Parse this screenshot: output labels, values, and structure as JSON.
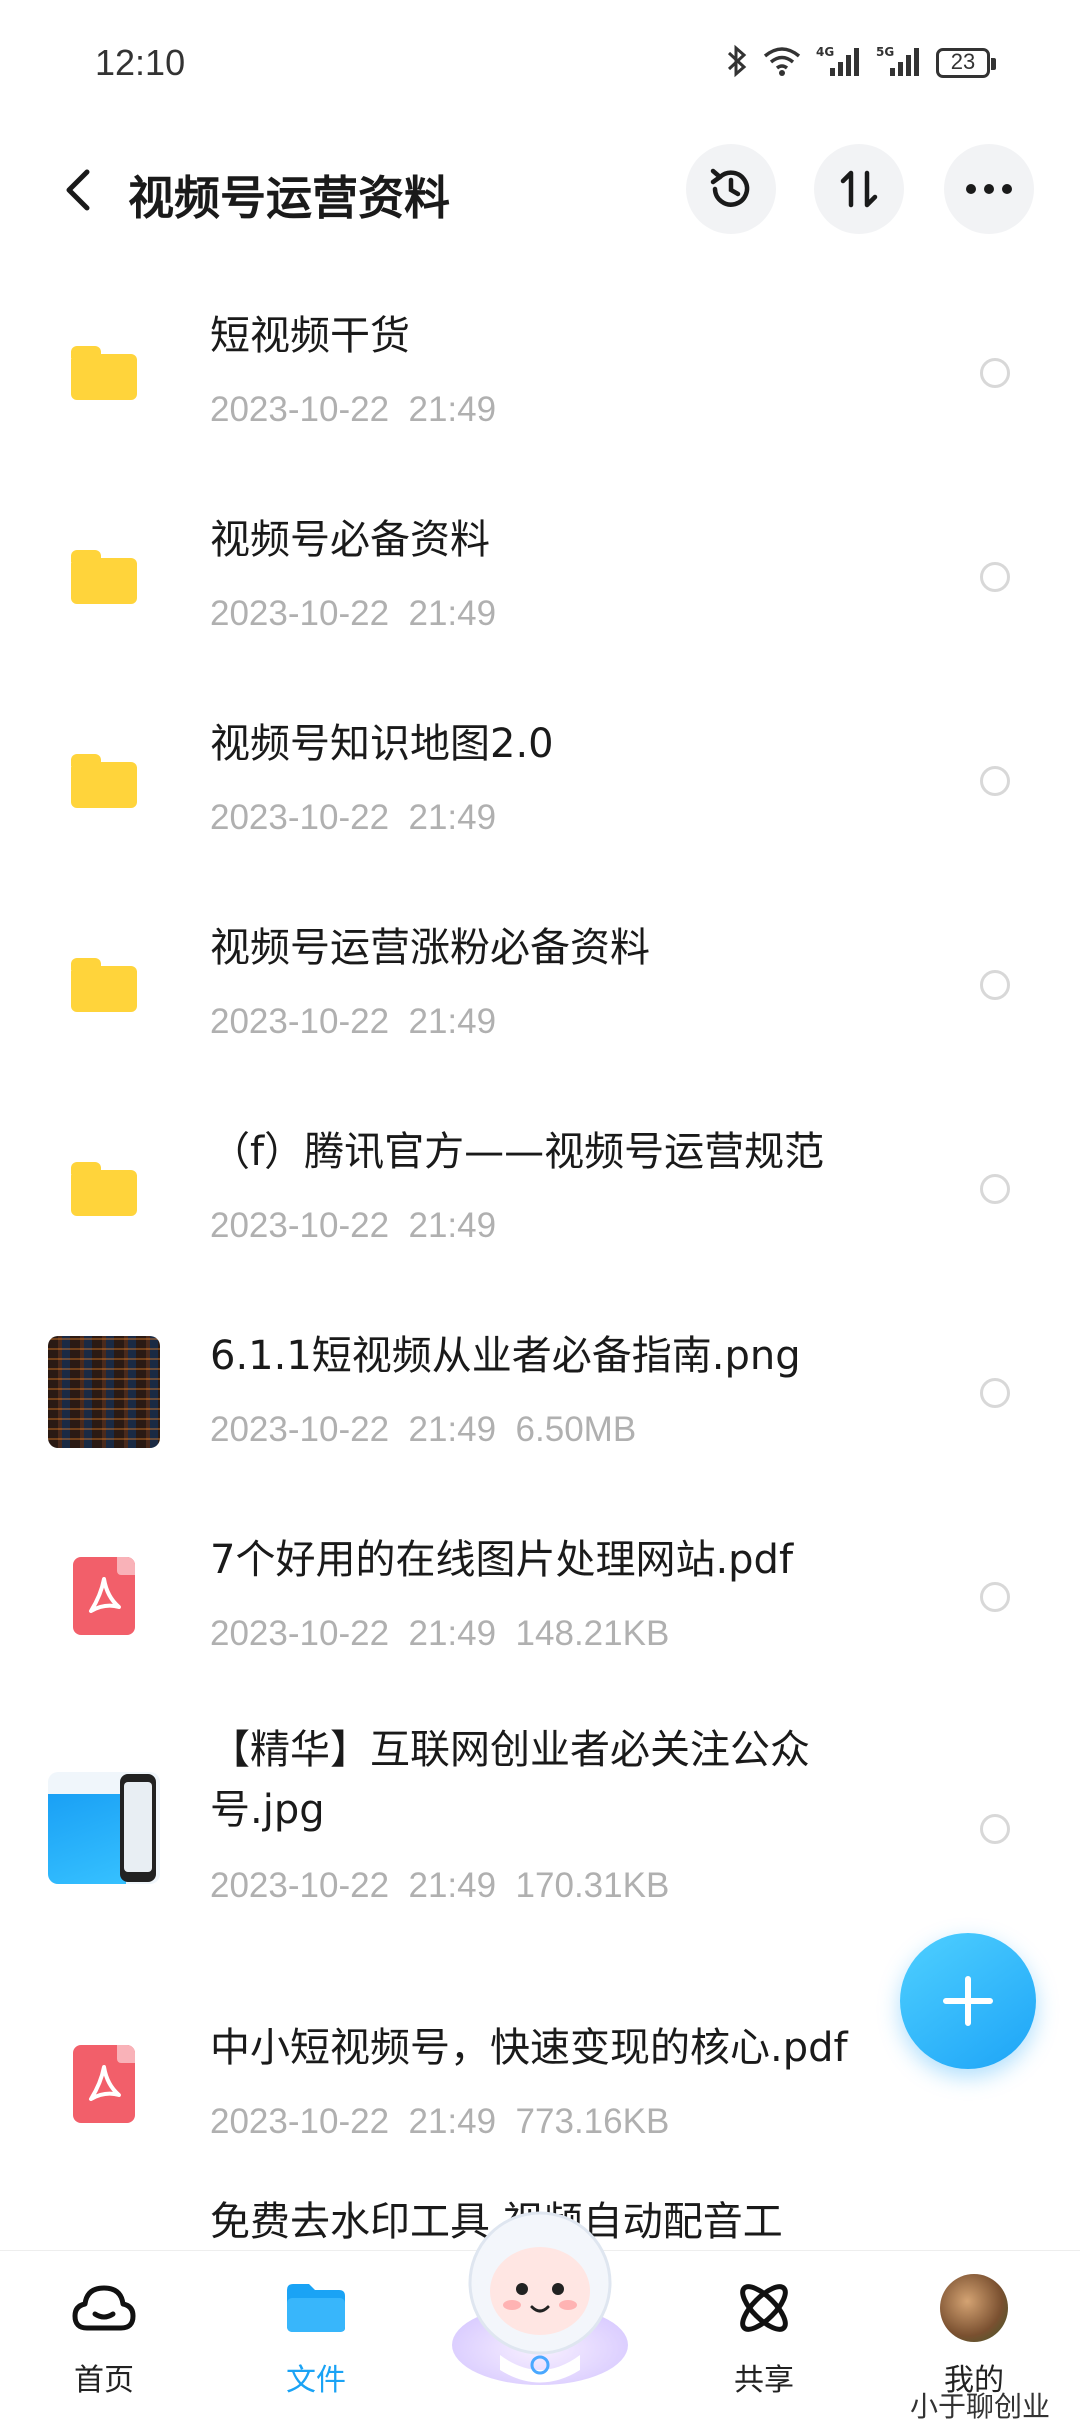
{
  "status_bar": {
    "time": "12:10",
    "network_1": "4G",
    "network_2": "5G",
    "battery": "23",
    "icons": [
      "bluetooth-icon",
      "wifi-icon",
      "signal-icon",
      "signal-icon",
      "battery-icon"
    ]
  },
  "header": {
    "title": "视频号运营资料",
    "back_icon": "chevron-left-icon",
    "actions": [
      "history-icon",
      "sort-icon",
      "more-icon"
    ]
  },
  "files": [
    {
      "name": "短视频干货",
      "date": "2023-10-22",
      "time": "21:49",
      "size": "",
      "type": "folder"
    },
    {
      "name": "视频号必备资料",
      "date": "2023-10-22",
      "time": "21:49",
      "size": "",
      "type": "folder"
    },
    {
      "name": "视频号知识地图2.0",
      "date": "2023-10-22",
      "time": "21:49",
      "size": "",
      "type": "folder"
    },
    {
      "name": "视频号运营涨粉必备资料",
      "date": "2023-10-22",
      "time": "21:49",
      "size": "",
      "type": "folder"
    },
    {
      "name": "（f）腾讯官方——视频号运营规范",
      "date": "2023-10-22",
      "time": "21:49",
      "size": "",
      "type": "folder"
    },
    {
      "name": "6.1.1短视频从业者必备指南.png",
      "date": "2023-10-22",
      "time": "21:49",
      "size": "6.50MB",
      "type": "image"
    },
    {
      "name": "7个好用的在线图片处理网站.pdf",
      "date": "2023-10-22",
      "time": "21:49",
      "size": "148.21KB",
      "type": "pdf"
    },
    {
      "name": "【精华】互联网创业者必关注公众号.jpg",
      "date": "2023-10-22",
      "time": "21:49",
      "size": "170.31KB",
      "type": "image"
    },
    {
      "name": "中小短视频号，快速变现的核心.pdf",
      "date": "2023-10-22",
      "time": "21:49",
      "size": "773.16KB",
      "type": "pdf"
    },
    {
      "name": "免费去水印工具   视频自动配音工",
      "date": "",
      "time": "",
      "size": "",
      "type": "pdf"
    }
  ],
  "fab": {
    "icon": "plus-icon"
  },
  "bottom_nav": [
    {
      "label": "首页",
      "icon": "cloud-home-icon",
      "active": false
    },
    {
      "label": "文件",
      "icon": "folder-icon",
      "active": true
    },
    {
      "label": "共享",
      "icon": "share-atom-icon",
      "active": false
    },
    {
      "label": "我的",
      "icon": "avatar",
      "active": false
    }
  ],
  "watermark": "小于聊创业",
  "colors": {
    "accent": "#1aa3f5",
    "folder": "#ffd43b",
    "pdf": "#f25f6a",
    "meta_text": "#b0b0b0"
  }
}
